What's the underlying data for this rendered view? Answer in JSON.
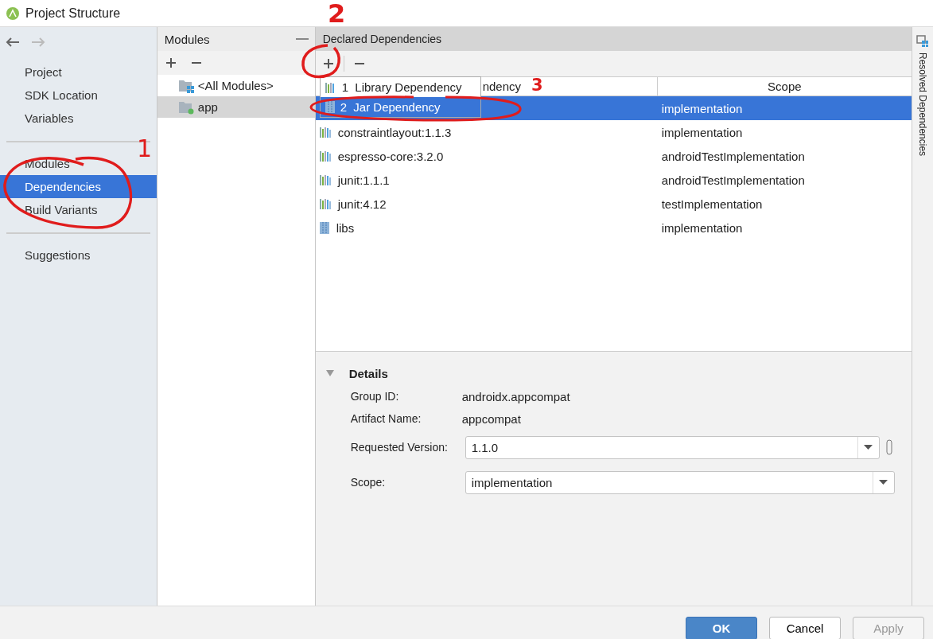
{
  "window": {
    "title": "Project Structure"
  },
  "sidebar": {
    "groups": [
      {
        "items": [
          {
            "label": "Project",
            "selected": false
          },
          {
            "label": "SDK Location",
            "selected": false
          },
          {
            "label": "Variables",
            "selected": false
          }
        ]
      },
      {
        "items": [
          {
            "label": "Modules",
            "selected": false
          },
          {
            "label": "Dependencies",
            "selected": true
          },
          {
            "label": "Build Variants",
            "selected": false
          }
        ]
      },
      {
        "items": [
          {
            "label": "Suggestions",
            "selected": false
          }
        ]
      }
    ]
  },
  "modules": {
    "title": "Modules",
    "items": [
      {
        "label": "<All Modules>",
        "kind": "all",
        "selected": false
      },
      {
        "label": "app",
        "kind": "module",
        "selected": true
      }
    ]
  },
  "dependencies": {
    "title": "Declared Dependencies",
    "columns": [
      "ndency",
      "Scope"
    ],
    "rows": [
      {
        "scope": "implementation",
        "selected": true
      },
      {
        "name": "constraintlayout:1.1.3",
        "kind": "library",
        "scope": "implementation",
        "selected": false
      },
      {
        "name": "espresso-core:3.2.0",
        "kind": "library",
        "scope": "androidTestImplementation",
        "selected": false
      },
      {
        "name": "junit:1.1.1",
        "kind": "library",
        "scope": "androidTestImplementation",
        "selected": false
      },
      {
        "name": "junit:4.12",
        "kind": "library",
        "scope": "testImplementation",
        "selected": false
      },
      {
        "name": "libs",
        "kind": "jar",
        "scope": "implementation",
        "selected": false
      }
    ]
  },
  "add_menu": {
    "items": [
      {
        "label": "1  Library Dependency",
        "kind": "library",
        "selected": false
      },
      {
        "label": "2  Jar Dependency",
        "kind": "jar",
        "selected": true
      }
    ]
  },
  "details": {
    "title": "Details",
    "expanded": true,
    "fields": [
      {
        "label": "Group ID:",
        "value": "androidx.appcompat",
        "kind": "text"
      },
      {
        "label": "Artifact Name:",
        "value": "appcompat",
        "kind": "text"
      },
      {
        "label": "Requested Version:",
        "value": "1.1.0",
        "kind": "combo-extra"
      },
      {
        "label": "Scope:",
        "value": "implementation",
        "kind": "combo"
      }
    ]
  },
  "side_tab": {
    "label": "Resolved Dependencies"
  },
  "buttons": [
    {
      "label": "OK",
      "kind": "primary",
      "disabled": false
    },
    {
      "label": "Cancel",
      "kind": "normal",
      "disabled": false
    },
    {
      "label": "Apply",
      "kind": "normal",
      "disabled": true
    }
  ],
  "annotations": [
    {
      "label": "1"
    },
    {
      "label": "2"
    },
    {
      "label": "3"
    }
  ]
}
